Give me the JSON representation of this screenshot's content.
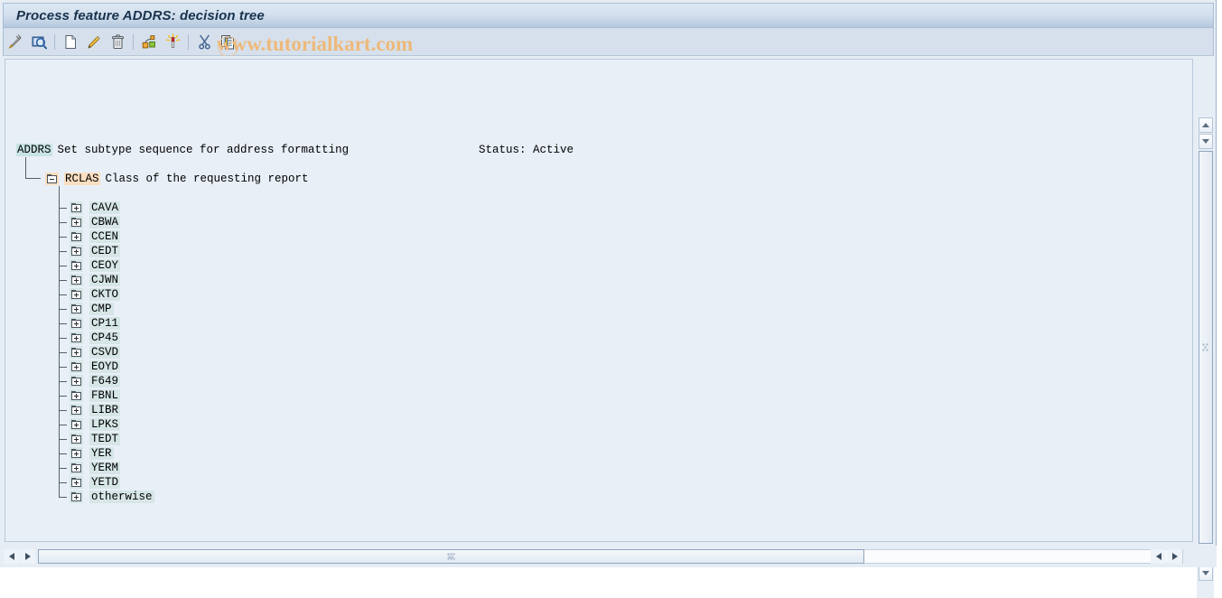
{
  "window": {
    "title": "Process feature ADDRS: decision tree",
    "watermark": "www.tutorialkart.com"
  },
  "toolbar": {
    "buttons": [
      {
        "name": "check-pencil-icon",
        "label": "Check"
      },
      {
        "name": "display-magnifier-icon",
        "label": "Display"
      },
      {
        "name": "new-document-icon",
        "label": "Create"
      },
      {
        "name": "edit-pencil-icon",
        "label": "Change"
      },
      {
        "name": "delete-trash-icon",
        "label": "Delete"
      },
      {
        "name": "structure-nodes-icon",
        "label": "Structure"
      },
      {
        "name": "generate-wand-icon",
        "label": "Generate"
      },
      {
        "name": "cut-scissors-icon",
        "label": "Cut"
      },
      {
        "name": "copy-pages-icon",
        "label": "Copy"
      }
    ]
  },
  "tree": {
    "root": {
      "key": "ADDRS",
      "description": "Set subtype sequence for address formatting"
    },
    "status": "Status: Active",
    "field_node": {
      "key": "RCLAS",
      "description": "Class of the requesting report",
      "expanded": true
    },
    "children": [
      {
        "label": "CAVA"
      },
      {
        "label": "CBWA"
      },
      {
        "label": "CCEN"
      },
      {
        "label": "CEDT"
      },
      {
        "label": "CEOY"
      },
      {
        "label": "CJWN"
      },
      {
        "label": "CKTO"
      },
      {
        "label": "CMP"
      },
      {
        "label": "CP11"
      },
      {
        "label": "CP45"
      },
      {
        "label": "CSVD"
      },
      {
        "label": "EOYD"
      },
      {
        "label": "F649"
      },
      {
        "label": "FBNL"
      },
      {
        "label": "LIBR"
      },
      {
        "label": "LPKS"
      },
      {
        "label": "TEDT"
      },
      {
        "label": "YER"
      },
      {
        "label": "YERM"
      },
      {
        "label": "YETD"
      },
      {
        "label": "otherwise"
      }
    ]
  },
  "colors": {
    "root_highlight": "#c8e4e4",
    "field_highlight": "#fbdfc0",
    "node_highlight": "#d6e6e6",
    "title_text": "#19334d",
    "watermark": "#edb97a",
    "panel_background": "#e8eff7"
  }
}
